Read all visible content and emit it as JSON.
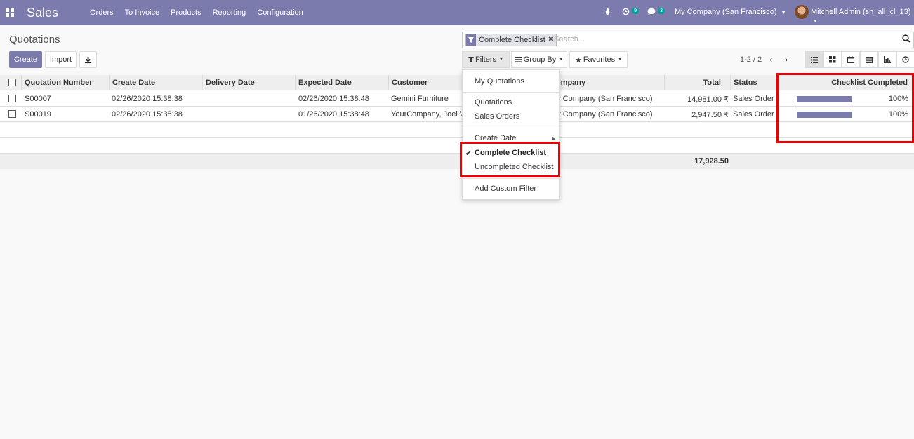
{
  "nav": {
    "brand": "Sales",
    "menu": [
      "Orders",
      "To Invoice",
      "Products",
      "Reporting",
      "Configuration"
    ],
    "activity_count": "9",
    "message_count": "3",
    "company": "My Company (San Francisco)",
    "user": "Mitchell Admin (sh_all_cl_13)"
  },
  "control": {
    "title": "Quotations",
    "create_label": "Create",
    "import_label": "Import",
    "facet_label": "Complete Checklist",
    "facet_close": "✖",
    "search_placeholder": "Search...",
    "filters_label": "Filters",
    "groupby_label": "Group By",
    "favorites_label": "Favorites",
    "pager": "1-2 / 2"
  },
  "table": {
    "headers": {
      "quotation_number": "Quotation Number",
      "create_date": "Create Date",
      "delivery_date": "Delivery Date",
      "expected_date": "Expected Date",
      "customer": "Customer",
      "company": "Company",
      "total": "Total",
      "status": "Status",
      "checklist": "Checklist Completed"
    },
    "rows": [
      {
        "number": "S00007",
        "create_date": "02/26/2020 15:38:38",
        "expected_date": "02/26/2020 15:38:48",
        "customer": "Gemini Furniture",
        "company": "My Company (San Francisco)",
        "total": "14,981.00 ₹",
        "status": "Sales Order",
        "checklist_pct": "100%",
        "checklist_value": 1.0
      },
      {
        "number": "S00019",
        "create_date": "02/26/2020 15:38:38",
        "expected_date": "01/26/2020 15:38:48",
        "customer": "YourCompany, Joel Willis",
        "company": "My Company (San Francisco)",
        "total": "2,947.50 ₹",
        "status": "Sales Order",
        "checklist_pct": "100%",
        "checklist_value": 1.0
      }
    ],
    "sum_total": "17,928.50"
  },
  "dropdown": {
    "my_quotations": "My Quotations",
    "quotations": "Quotations",
    "sales_orders": "Sales Orders",
    "create_date": "Create Date",
    "complete_checklist": "Complete Checklist",
    "uncompleted_checklist": "Uncompleted Checklist",
    "add_custom_filter": "Add Custom Filter"
  },
  "colors": {
    "brand": "#7c7bad",
    "highlight": "#ee0000",
    "badge": "#00a09d"
  }
}
